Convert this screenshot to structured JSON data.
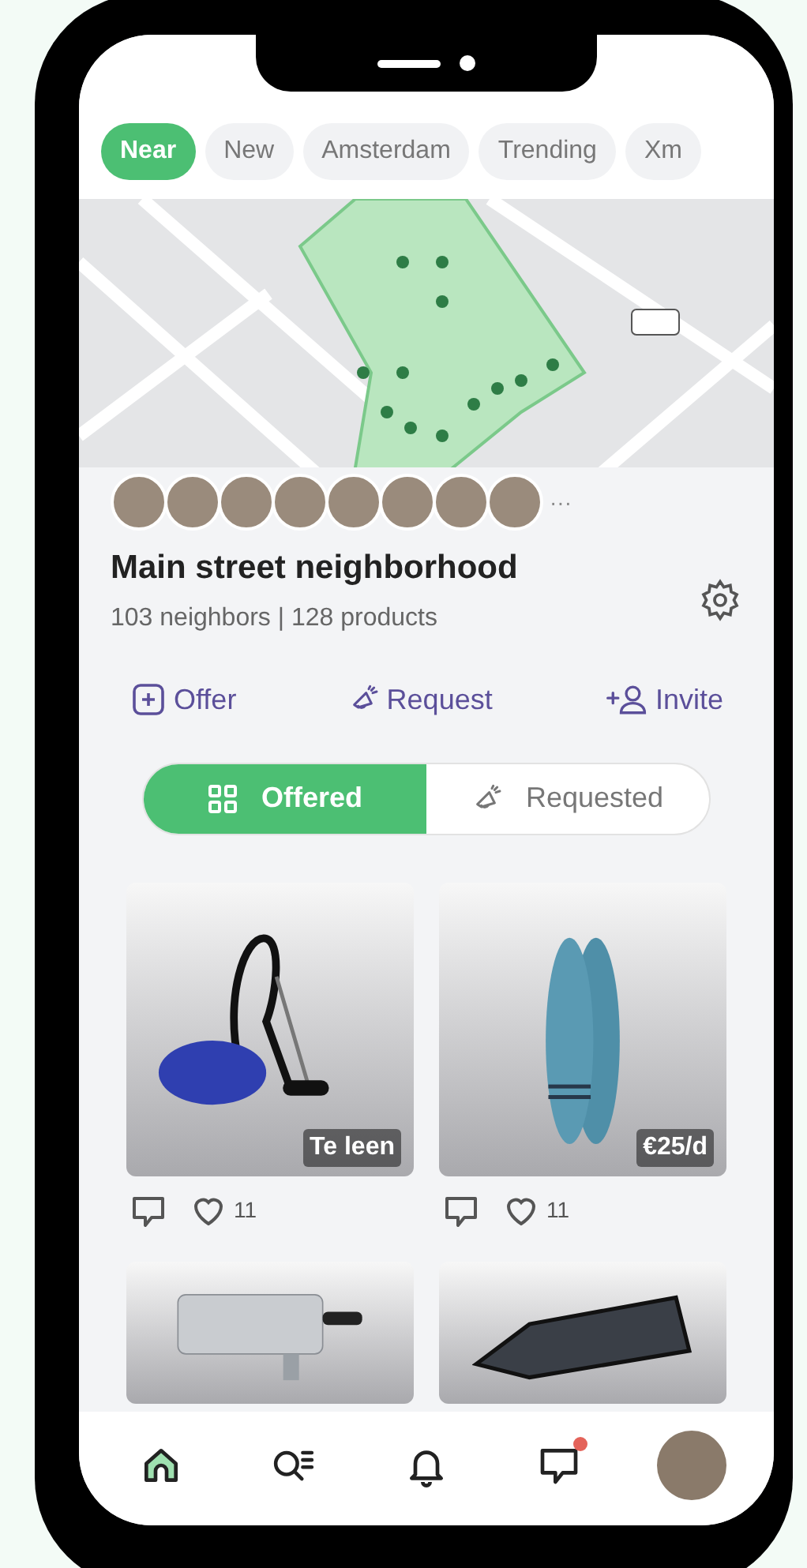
{
  "filters": [
    {
      "label": "Near",
      "selected": true
    },
    {
      "label": "New",
      "selected": false
    },
    {
      "label": "Amsterdam",
      "selected": false
    },
    {
      "label": "Trending",
      "selected": false
    },
    {
      "label": "Xm",
      "selected": false
    }
  ],
  "neighborhood": {
    "more": "···",
    "title": "Main street neighborhood",
    "stats": "103 neighbors | 128 products"
  },
  "actions": [
    {
      "label": "Offer",
      "kind": "offer"
    },
    {
      "label": "Request",
      "kind": "request"
    },
    {
      "label": "Invite",
      "kind": "invite"
    }
  ],
  "segments": [
    {
      "label": "Offered",
      "kind": "grid",
      "selected": true
    },
    {
      "label": "Requested",
      "kind": "request",
      "selected": false
    }
  ],
  "products": [
    {
      "kind": "vacuum",
      "badge": "Te leen",
      "likes": "11"
    },
    {
      "kind": "paddleboard",
      "badge": "€25/d",
      "likes": "11"
    },
    {
      "kind": "pasta-maker"
    },
    {
      "kind": "tray"
    }
  ],
  "nav": [
    {
      "kind": "home",
      "selected": true
    },
    {
      "kind": "search",
      "selected": false
    },
    {
      "kind": "bell",
      "selected": false
    },
    {
      "kind": "chat",
      "selected": false,
      "unread": true
    },
    {
      "kind": "avatar",
      "selected": false
    }
  ]
}
